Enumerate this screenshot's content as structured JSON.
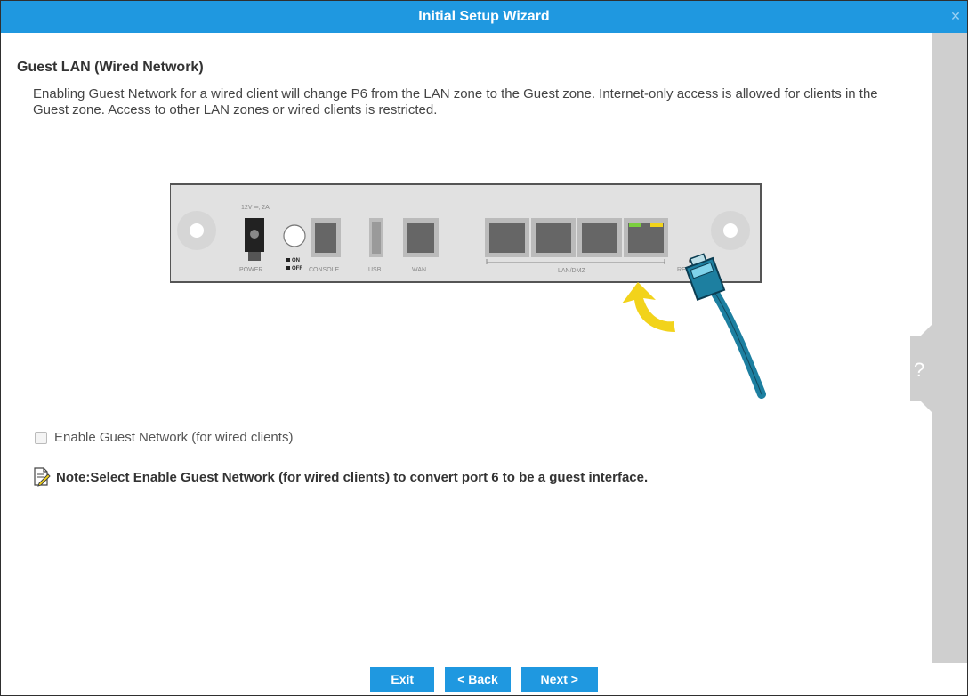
{
  "window": {
    "title": "Initial Setup Wizard",
    "close_icon": "close-icon"
  },
  "main": {
    "section_title": "Guest LAN (Wired Network)",
    "description": "Enabling Guest Network for a wired client will change P6 from the LAN zone to the Guest zone. Internet-only access is allowed for clients in the Guest zone. Access to other LAN zones or wired clients is restricted.",
    "device": {
      "power_rating": "12V ═, 2A",
      "labels": {
        "power": "POWER",
        "on": "ON",
        "off": "OFF",
        "console": "CONSOLE",
        "usb": "USB",
        "wan": "WAN",
        "lan_dmz": "LAN/DMZ",
        "reset": "RESET"
      }
    },
    "checkbox": {
      "label": "Enable Guest Network (for wired clients)",
      "checked": false
    },
    "note": {
      "text": "Note:Select Enable Guest Network (for wired clients) to convert port 6 to be a guest interface.",
      "icon": "note-edit-icon"
    }
  },
  "help": {
    "label": "?"
  },
  "footer": {
    "exit_label": "Exit",
    "back_label": "< Back",
    "next_label": "Next >"
  },
  "colors": {
    "accent": "#1f98e0",
    "arrow": "#f2d31b",
    "cable": "#1d7fa0",
    "scrollbar": "#cfcfcf"
  }
}
